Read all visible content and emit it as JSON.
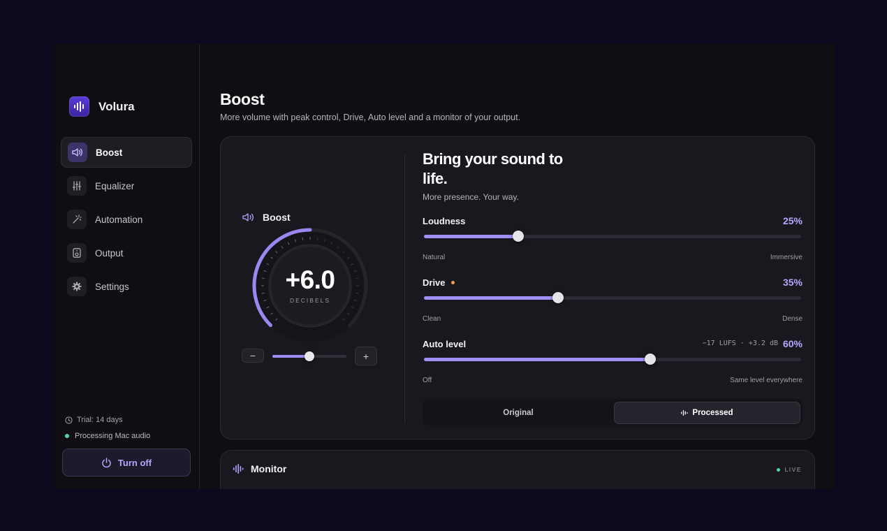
{
  "app": {
    "name": "Volura"
  },
  "sidebar": {
    "items": [
      {
        "label": "Boost",
        "icon": "speaker-icon",
        "active": true
      },
      {
        "label": "Equalizer",
        "icon": "sliders-icon",
        "active": false
      },
      {
        "label": "Automation",
        "icon": "magic-wand-icon",
        "active": false
      },
      {
        "label": "Output",
        "icon": "speaker-box-icon",
        "active": false
      },
      {
        "label": "Settings",
        "icon": "gear-icon",
        "active": false
      }
    ],
    "trial": "Trial: 14 days",
    "status": "Processing Mac audio",
    "turn_off": "Turn off"
  },
  "page": {
    "title": "Boost",
    "subtitle": "More volume with peak control, Drive, Auto level and a monitor of your output."
  },
  "boost": {
    "label": "Boost",
    "value": "+6.0",
    "unit": "DECIBELS",
    "knob_fraction": 0.5,
    "mini_slider_fraction": 0.5,
    "minus": "−",
    "plus": "+"
  },
  "hero": {
    "title": "Bring your sound to life.",
    "subtitle": "More presence. Your way."
  },
  "sliders": [
    {
      "label": "Loudness",
      "value": "25%",
      "fraction": 0.25,
      "low": "Natural",
      "high": "Immersive",
      "meta": ""
    },
    {
      "label": "Drive",
      "value": "35%",
      "fraction": 0.355,
      "low": "Clean",
      "high": "Dense",
      "meta": ""
    },
    {
      "label": "Auto level",
      "value": "60%",
      "fraction": 0.6,
      "low": "Off",
      "high": "Same level everywhere",
      "meta": "−17 LUFS · +3.2 dB"
    }
  ],
  "compare": {
    "original": "Original",
    "processed": "Processed",
    "selected": "processed"
  },
  "monitor": {
    "title": "Monitor",
    "live": "LIVE"
  },
  "colors": {
    "accent": "#a18ff7",
    "accent_text": "#b6a6ff",
    "live": "#58d6a4",
    "drive_dot": "#f5a04d"
  }
}
